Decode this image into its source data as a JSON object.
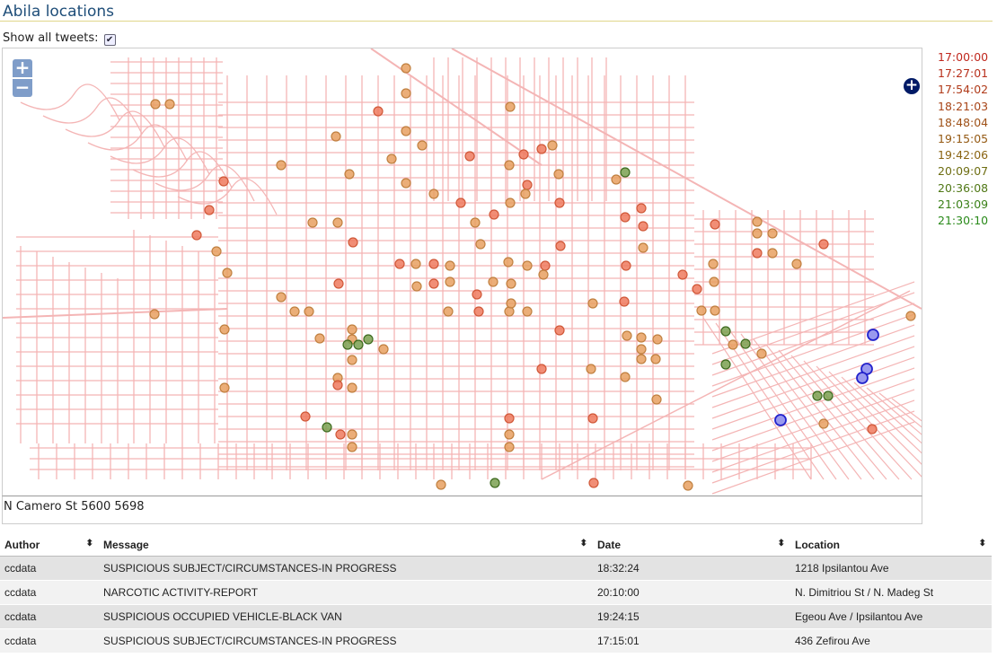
{
  "header": {
    "title": "Abila locations"
  },
  "controls": {
    "show_all_label": "Show all tweets:",
    "show_all_checked": true
  },
  "map": {
    "zoom_in_label": "+",
    "zoom_out_label": "−",
    "layer_toggle_label": "+",
    "street_color": "#f4b5b5",
    "hover_street": "N Camero St 5600 5698"
  },
  "timeline": [
    {
      "time": "17:00:00",
      "color": "#c0281e"
    },
    {
      "time": "17:27:01",
      "color": "#b8301c"
    },
    {
      "time": "17:54:02",
      "color": "#b03b1a"
    },
    {
      "time": "18:21:03",
      "color": "#a84518"
    },
    {
      "time": "18:48:04",
      "color": "#9e5016"
    },
    {
      "time": "19:15:05",
      "color": "#955a14"
    },
    {
      "time": "19:42:06",
      "color": "#8a6412"
    },
    {
      "time": "20:09:07",
      "color": "#6e6e12"
    },
    {
      "time": "20:36:08",
      "color": "#507816"
    },
    {
      "time": "21:03:09",
      "color": "#3a8018"
    },
    {
      "time": "21:30:10",
      "color": "#2a8a1a"
    }
  ],
  "table": {
    "columns": [
      "Author",
      "Message",
      "Date",
      "Location"
    ],
    "rows": [
      {
        "author": "ccdata",
        "message": "SUSPICIOUS SUBJECT/CIRCUMSTANCES-IN PROGRESS",
        "date": "18:32:24",
        "location": "1218 Ipsilantou Ave"
      },
      {
        "author": "ccdata",
        "message": "NARCOTIC ACTIVITY-REPORT",
        "date": "20:10:00",
        "location": "N. Dimitriou St / N. Madeg St"
      },
      {
        "author": "ccdata",
        "message": "SUSPICIOUS OCCUPIED VEHICLE-BLACK VAN",
        "date": "19:24:15",
        "location": "Egeou Ave / Ipsilantou Ave"
      },
      {
        "author": "ccdata",
        "message": "SUSPICIOUS SUBJECT/CIRCUMSTANCES-IN PROGRESS",
        "date": "17:15:01",
        "location": "436 Zefirou Ave"
      }
    ]
  }
}
